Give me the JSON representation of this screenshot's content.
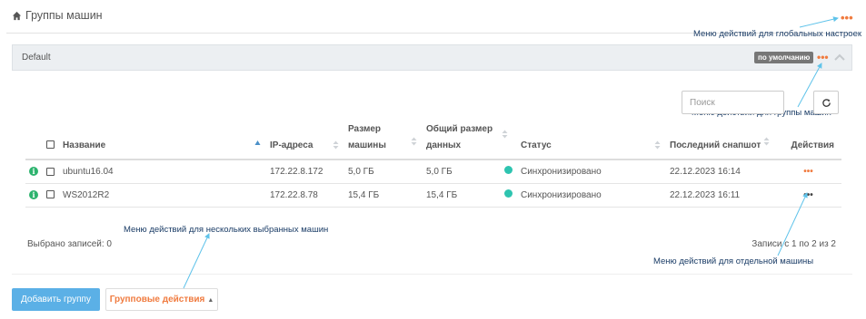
{
  "header": {
    "title": "Группы машин"
  },
  "group": {
    "name": "Default",
    "badge": "по умолчанию",
    "dots": "•••"
  },
  "search": {
    "placeholder": "Поиск"
  },
  "table": {
    "headers": {
      "name": "Название",
      "ip": "IP-адреса",
      "size": "Размер машины",
      "total": "Общий размер данных",
      "status": "Статус",
      "snapshot": "Последний снапшот",
      "actions": "Действия"
    },
    "rows": [
      {
        "name": "ubuntu16.04",
        "ip": "172.22.8.172",
        "size": "5,0 ГБ",
        "total": "5,0 ГБ",
        "status": "Синхронизировано",
        "snapshot": "22.12.2023 16:14",
        "actions": "•••"
      },
      {
        "name": "WS2012R2",
        "ip": "172.22.8.78",
        "size": "15,4 ГБ",
        "total": "15,4 ГБ",
        "status": "Синхронизировано",
        "snapshot": "22.12.2023 16:11",
        "actions": "•••"
      }
    ]
  },
  "footer": {
    "selected": "Выбрано записей: 0",
    "records": "Записи с 1 по 2 из 2",
    "add_button": "Добавить группу",
    "group_actions": "Групповые действия"
  },
  "annotations": {
    "global": "Меню действий для глобальных настроек",
    "group": "Меню действий для группы машин",
    "multiple": "Меню действий для нескольких выбранных машин",
    "single": "Меню действий для отдельной машины"
  },
  "colors": {
    "accent": "#f07b3f",
    "primary_button": "#5bb0e6",
    "status_dot": "#2ec4b0",
    "info_icon": "#2db36e",
    "annotation": "#1a3c66",
    "arrow": "#5fc3ea"
  }
}
